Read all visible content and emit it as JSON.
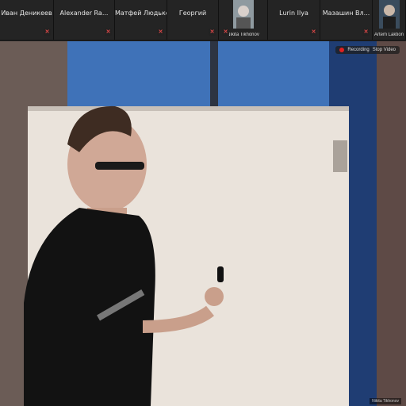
{
  "participants": [
    {
      "name": "Иван Деникеев",
      "muted": true
    },
    {
      "name": "Alexander Ra...",
      "muted": true
    },
    {
      "name": "Матфей Людько",
      "muted": true
    },
    {
      "name": "Георгий",
      "muted": true
    },
    {
      "name": "Nikita Tikhonov",
      "muted": true,
      "video": true
    },
    {
      "name": "Lurin Ilya",
      "muted": true
    },
    {
      "name": "Мазашин Вл...",
      "muted": true
    },
    {
      "name": "Artem Laktionov",
      "muted": true,
      "video": true
    }
  ],
  "recording": {
    "label": "Recording",
    "action": "Stop Video"
  },
  "main_label": "Nikita Tikhonov",
  "colors": {
    "background": "#1a1a1a",
    "tile": "#242424",
    "muted": "#e04848",
    "recording": "#e02020"
  },
  "icons": [
    "microphone-muted-icon",
    "recording-dot-icon",
    "camera-icon"
  ]
}
